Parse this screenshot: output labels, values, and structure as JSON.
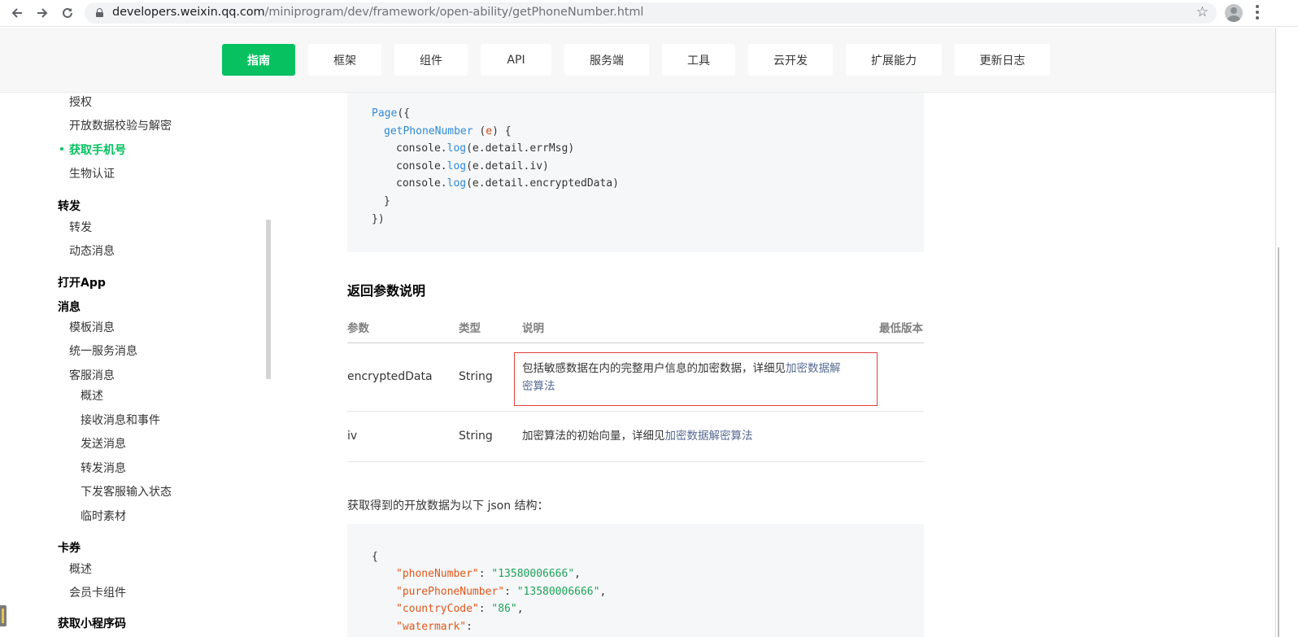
{
  "browser": {
    "url_host": "developers.weixin.qq.com",
    "url_path": "/miniprogram/dev/framework/open-ability/getPhoneNumber.html",
    "back_icon": "arrow-left-icon",
    "forward_icon": "arrow-right-icon",
    "reload_icon": "reload-icon",
    "star_icon": "star-icon"
  },
  "topnav": {
    "tabs": [
      {
        "label": "指南",
        "active": true
      },
      {
        "label": "框架"
      },
      {
        "label": "组件"
      },
      {
        "label": "API"
      },
      {
        "label": "服务端"
      },
      {
        "label": "工具"
      },
      {
        "label": "云开发"
      },
      {
        "label": "扩展能力"
      },
      {
        "label": "更新日志"
      }
    ],
    "accent_color": "#07c160"
  },
  "sidebar": {
    "items": [
      {
        "label": "授权"
      },
      {
        "label": "开放数据校验与解密"
      },
      {
        "label": "获取手机号",
        "active": true
      },
      {
        "label": "生物认证"
      },
      {
        "label": "转发",
        "heading": true
      },
      {
        "label": "转发"
      },
      {
        "label": "动态消息"
      },
      {
        "label": "打开App",
        "heading": true
      },
      {
        "label": "消息",
        "heading": true
      },
      {
        "label": "模板消息"
      },
      {
        "label": "统一服务消息"
      },
      {
        "label": "客服消息"
      },
      {
        "label": "概述"
      },
      {
        "label": "接收消息和事件"
      },
      {
        "label": "发送消息"
      },
      {
        "label": "转发消息"
      },
      {
        "label": "下发客服输入状态"
      },
      {
        "label": "临时素材"
      },
      {
        "label": "卡券",
        "heading": true
      },
      {
        "label": "概述"
      },
      {
        "label": "会员卡组件"
      },
      {
        "label": "获取小程序码",
        "heading": true
      }
    ]
  },
  "code1": {
    "l1_fn": "Page",
    "l1_rest": "({",
    "l2_fn": "getPhoneNumber",
    "l2_a": " (",
    "l2_param": "e",
    "l2_b": ") {",
    "l3_a": "console.",
    "l3_fn": "log",
    "l3_b": "(e.detail.errMsg)",
    "l4_a": "console.",
    "l4_fn": "log",
    "l4_b": "(e.detail.iv)",
    "l5_a": "console.",
    "l5_fn": "log",
    "l5_b": "(e.detail.encryptedData)",
    "l6": "}",
    "l7": "})"
  },
  "section": {
    "title": "返回参数说明",
    "headers": {
      "param": "参数",
      "type": "类型",
      "desc": "说明",
      "version": "最低版本"
    },
    "rows": [
      {
        "param": "encryptedData",
        "type": "String",
        "desc_text": "包括敏感数据在内的完整用户信息的加密数据，详细见",
        "desc_link_1": "加密数据解",
        "desc_link_2": "密算法",
        "version": ""
      },
      {
        "param": "iv",
        "type": "String",
        "desc_text": "加密算法的初始向量，详细见",
        "desc_link": "加密数据解密算法",
        "version": ""
      }
    ],
    "highlight_color": "#e53e3e",
    "link_color": "#576b95"
  },
  "para": "获取得到的开放数据为以下 json 结构：",
  "code2": {
    "open": "{",
    "k1": "\"phoneNumber\"",
    "v1": "\"13580006666\"",
    "k2": "\"purePhoneNumber\"",
    "v2": "\"13580006666\"",
    "k3": "\"countryCode\"",
    "v3": "\"86\"",
    "k4": "\"watermark\""
  }
}
